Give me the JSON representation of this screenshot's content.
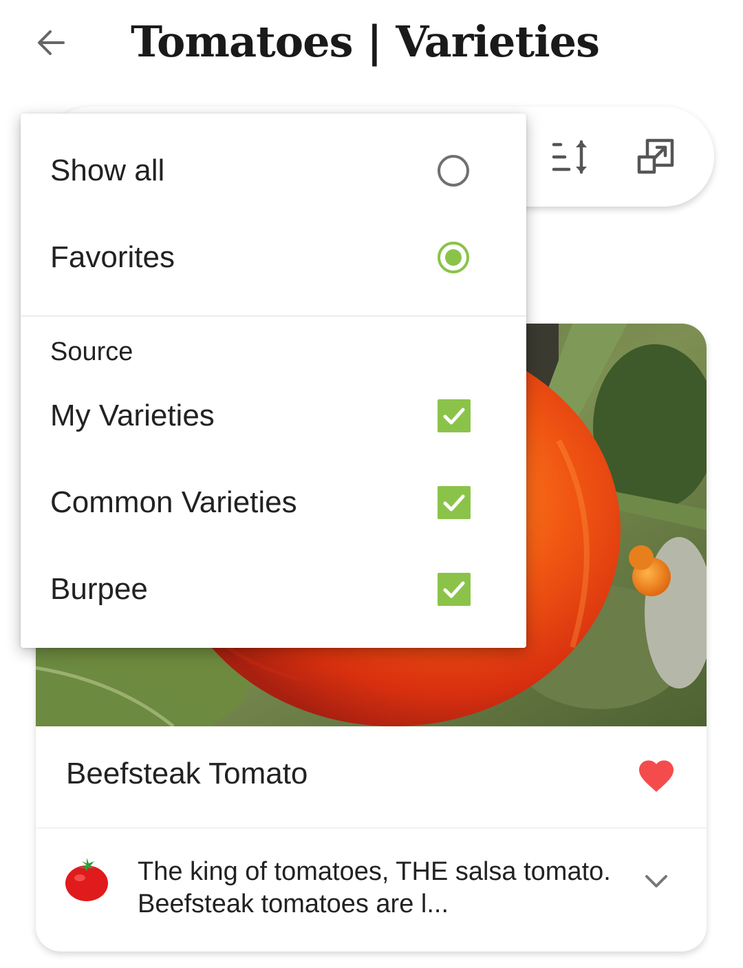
{
  "header": {
    "title": "Tomatoes | Varieties"
  },
  "icons": {
    "back": "arrow-left",
    "sort": "sort-up-down",
    "expand": "open-in-new-square",
    "favorite": "heart",
    "tomato": "tomato",
    "chevron": "chevron-down"
  },
  "colors": {
    "accent": "#8bc34a",
    "favorite": "#f44c4c",
    "radio_unselected": "#707070"
  },
  "filter_menu": {
    "items": [
      {
        "label": "Show all",
        "type": "radio",
        "selected": false
      },
      {
        "label": "Favorites",
        "type": "radio",
        "selected": true
      }
    ],
    "source_heading": "Source",
    "sources": [
      {
        "label": "My Varieties",
        "checked": true
      },
      {
        "label": "Common Varieties",
        "checked": true
      },
      {
        "label": "Burpee",
        "checked": true
      }
    ]
  },
  "card": {
    "title": "Beefsteak Tomato",
    "favorite": true,
    "description": "The king of tomatoes, THE salsa tomato. Beefsteak tomatoes are l..."
  }
}
